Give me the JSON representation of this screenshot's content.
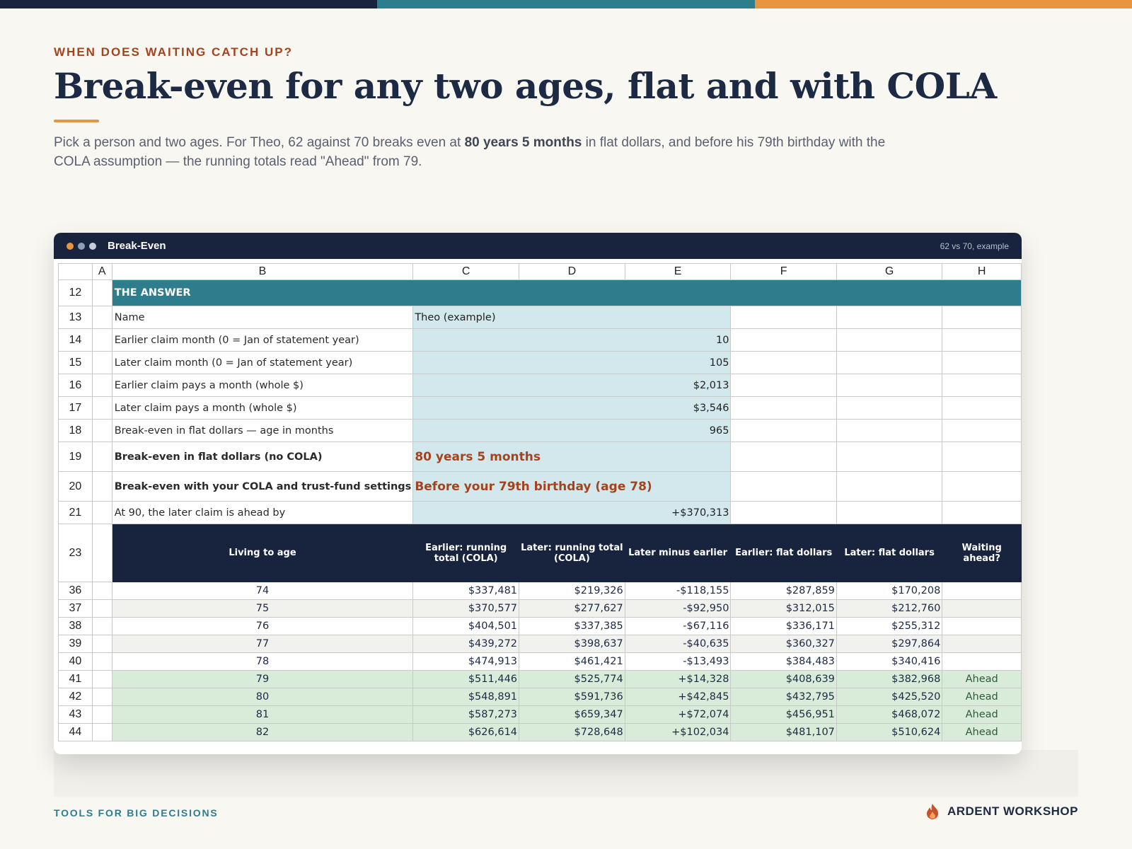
{
  "colors": {
    "navy": "#18233d",
    "teal": "#2e7d8c",
    "orange": "#e8953f",
    "rust": "#a3441e",
    "input_fill": "#d3e8ec",
    "ahead_fill": "#d9ecd9"
  },
  "eyebrow": "WHEN DOES WAITING CATCH UP?",
  "title": "Break-even for any two ages, flat and with COLA",
  "lede": {
    "before": "Pick a person and two ages. For Theo, 62 against 70 breaks even at ",
    "bold": "80 years 5 months",
    "after": " in flat dollars, and before his 79th birthday with the COLA assumption — the running totals read \"Ahead\" from 79."
  },
  "window": {
    "title": "Break-Even",
    "meta": "62 vs 70, example"
  },
  "sheet": {
    "columns": [
      "A",
      "B",
      "C",
      "D",
      "E",
      "F",
      "G",
      "H"
    ],
    "answer": {
      "row": "12",
      "banner": "THE ANSWER",
      "rows": [
        {
          "row": "13",
          "label": "Name",
          "value": "Theo (example)"
        },
        {
          "row": "14",
          "label": "Earlier claim month (0 = Jan of statement year)",
          "value": "10"
        },
        {
          "row": "15",
          "label": "Later claim month (0 = Jan of statement year)",
          "value": "105"
        },
        {
          "row": "16",
          "label": "Earlier claim pays a month (whole $)",
          "value": "$2,013"
        },
        {
          "row": "17",
          "label": "Later claim pays a month (whole $)",
          "value": "$3,546"
        },
        {
          "row": "18",
          "label": "Break-even in flat dollars — age in months",
          "value": "965"
        },
        {
          "row": "19",
          "label": "Break-even in flat dollars (no COLA)",
          "value": "80 years 5 months"
        },
        {
          "row": "20",
          "label": "Break-even with your COLA and trust-fund settings",
          "value": "Before your 79th birthday (age 78)"
        },
        {
          "row": "21",
          "label": "At 90, the later claim is ahead by",
          "value": "+$370,313"
        }
      ]
    },
    "table": {
      "header_row": "23",
      "headers": [
        "Living to age",
        "Earlier: running total (COLA)",
        "Later: running total (COLA)",
        "Later minus earlier",
        "Earlier: flat dollars",
        "Later: flat dollars",
        "Waiting ahead?"
      ],
      "rows": [
        {
          "row": "36",
          "age": "74",
          "e_cola": "$337,481",
          "l_cola": "$219,326",
          "diff": "-$118,155",
          "e_flat": "$287,859",
          "l_flat": "$170,208",
          "ahead": ""
        },
        {
          "row": "37",
          "age": "75",
          "e_cola": "$370,577",
          "l_cola": "$277,627",
          "diff": "-$92,950",
          "e_flat": "$312,015",
          "l_flat": "$212,760",
          "ahead": ""
        },
        {
          "row": "38",
          "age": "76",
          "e_cola": "$404,501",
          "l_cola": "$337,385",
          "diff": "-$67,116",
          "e_flat": "$336,171",
          "l_flat": "$255,312",
          "ahead": ""
        },
        {
          "row": "39",
          "age": "77",
          "e_cola": "$439,272",
          "l_cola": "$398,637",
          "diff": "-$40,635",
          "e_flat": "$360,327",
          "l_flat": "$297,864",
          "ahead": ""
        },
        {
          "row": "40",
          "age": "78",
          "e_cola": "$474,913",
          "l_cola": "$461,421",
          "diff": "-$13,493",
          "e_flat": "$384,483",
          "l_flat": "$340,416",
          "ahead": ""
        },
        {
          "row": "41",
          "age": "79",
          "e_cola": "$511,446",
          "l_cola": "$525,774",
          "diff": "+$14,328",
          "e_flat": "$408,639",
          "l_flat": "$382,968",
          "ahead": "Ahead"
        },
        {
          "row": "42",
          "age": "80",
          "e_cola": "$548,891",
          "l_cola": "$591,736",
          "diff": "+$42,845",
          "e_flat": "$432,795",
          "l_flat": "$425,520",
          "ahead": "Ahead"
        },
        {
          "row": "43",
          "age": "81",
          "e_cola": "$587,273",
          "l_cola": "$659,347",
          "diff": "+$72,074",
          "e_flat": "$456,951",
          "l_flat": "$468,072",
          "ahead": "Ahead"
        },
        {
          "row": "44",
          "age": "82",
          "e_cola": "$626,614",
          "l_cola": "$728,648",
          "diff": "+$102,034",
          "e_flat": "$481,107",
          "l_flat": "$510,624",
          "ahead": "Ahead"
        }
      ]
    }
  },
  "footer": {
    "tagline": "TOOLS FOR BIG DECISIONS",
    "brand": "ARDENT WORKSHOP",
    "brand_icon": "flame-icon"
  }
}
